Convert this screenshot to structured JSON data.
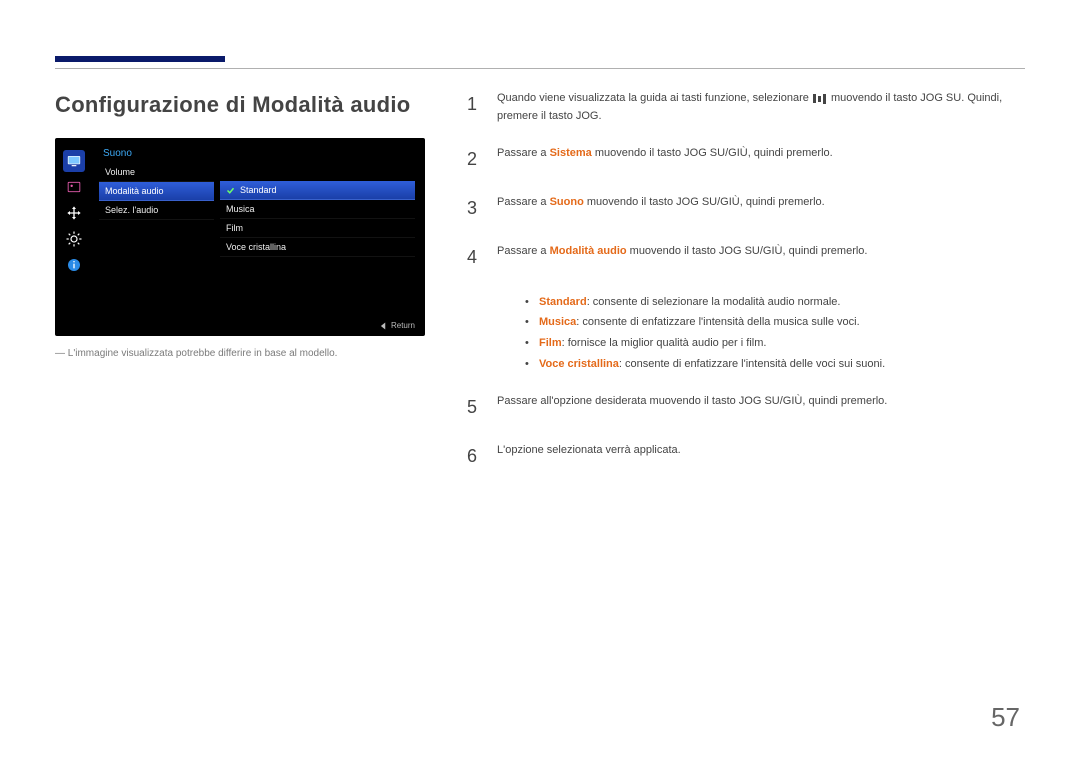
{
  "heading": "Configurazione di Modalità audio",
  "osd": {
    "menu_title": "Suono",
    "left_items": [
      "Volume",
      "Modalità audio",
      "Selez. l'audio"
    ],
    "selected_left_index": 1,
    "right_items": [
      "Standard",
      "Musica",
      "Film",
      "Voce cristallina"
    ],
    "selected_right_index": 0,
    "return_label": "Return"
  },
  "footnote": "L'immagine visualizzata potrebbe differire in base al modello.",
  "steps": {
    "s1_prefix": "Quando viene visualizzata la guida ai tasti funzione, selezionare ",
    "s1_suffix": " muovendo il tasto JOG SU. Quindi, premere il tasto JOG.",
    "s2_prefix": "Passare a ",
    "s2_link": "Sistema",
    "s2_suffix": " muovendo il tasto JOG SU/GIÙ, quindi premerlo.",
    "s3_prefix": "Passare a ",
    "s3_link": "Suono",
    "s3_suffix": " muovendo il tasto JOG SU/GIÙ, quindi premerlo.",
    "s4_prefix": "Passare a ",
    "s4_link": "Modalità audio",
    "s4_suffix": " muovendo il tasto JOG SU/GIÙ, quindi premerlo.",
    "s5": "Passare all'opzione desiderata muovendo il tasto JOG SU/GIÙ, quindi premerlo.",
    "s6": "L'opzione selezionata verrà applicata."
  },
  "bullets": {
    "b1_term": "Standard",
    "b1_desc": ": consente di selezionare la modalità audio normale.",
    "b2_term": "Musica",
    "b2_desc": ": consente di enfatizzare l'intensità della musica sulle voci.",
    "b3_term": "Film",
    "b3_desc": ": fornisce la miglior qualità audio per i film.",
    "b4_term": "Voce cristallina",
    "b4_desc": ": consente di enfatizzare l'intensità delle voci sui suoni."
  },
  "page_number": "57"
}
